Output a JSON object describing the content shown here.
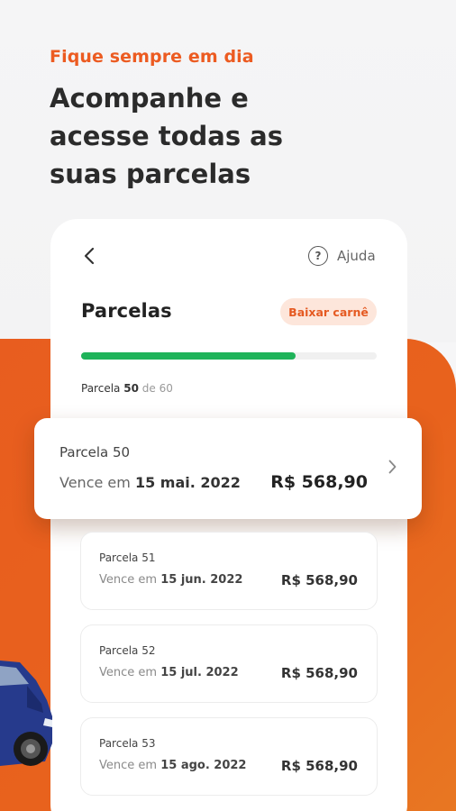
{
  "hero": {
    "kicker": "Fique sempre em dia",
    "headline": "Acompanhe e acesse todas as suas parcelas"
  },
  "header": {
    "help_label": "Ajuda"
  },
  "installments": {
    "title": "Parcelas",
    "download_label": "Baixar carnê",
    "progress": {
      "prefix": "Parcela",
      "current": "50",
      "of_text": "de 60",
      "fraction": 0.725
    },
    "current": {
      "label": "Parcela 50",
      "due_prefix": "Vence em",
      "due_date": "15 mai. 2022",
      "amount": "R$ 568,90"
    },
    "items": [
      {
        "label": "Parcela 51",
        "due_prefix": "Vence em",
        "due_date": "15 jun. 2022",
        "amount": "R$ 568,90"
      },
      {
        "label": "Parcela 52",
        "due_prefix": "Vence em",
        "due_date": "15 jul. 2022",
        "amount": "R$ 568,90"
      },
      {
        "label": "Parcela 53",
        "due_prefix": "Vence em",
        "due_date": "15 ago. 2022",
        "amount": "R$ 568,90"
      }
    ]
  },
  "colors": {
    "accent": "#ec5b21",
    "progress": "#1fb35a",
    "badge_bg": "#fde6db"
  },
  "icons": {
    "back": "chevron-left-icon",
    "help": "question-circle-icon",
    "next": "chevron-right-icon"
  }
}
